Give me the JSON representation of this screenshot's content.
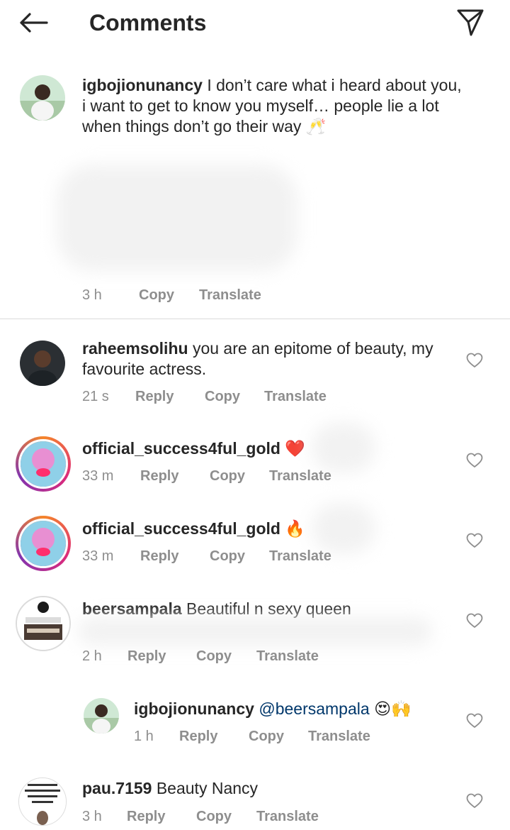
{
  "header": {
    "title": "Comments",
    "back_icon": "arrow-left-icon",
    "share_icon": "send-icon"
  },
  "caption": {
    "username": "igbojionunancy",
    "text": "I don’t care what i heard about you, i want to get to know you myself… people lie a lot when things don’t go their way 🥂",
    "time": "3 h",
    "copy": "Copy",
    "translate": "Translate"
  },
  "comments": [
    {
      "username": "raheemsolihu",
      "text": "you are an epitome of beauty, my favourite actress.",
      "time": "21 s",
      "reply": "Reply",
      "copy": "Copy",
      "translate": "Translate"
    },
    {
      "username": "official_success4ful_gold",
      "text": "❤️",
      "time": "33 m",
      "reply": "Reply",
      "copy": "Copy",
      "translate": "Translate"
    },
    {
      "username": "official_success4ful_gold",
      "text": "🔥",
      "time": "33 m",
      "reply": "Reply",
      "copy": "Copy",
      "translate": "Translate"
    },
    {
      "username": "beersampala",
      "text": "Beautiful n sexy queen",
      "time": "2 h",
      "reply": "Reply",
      "copy": "Copy",
      "translate": "Translate"
    },
    {
      "username": "igbojionunancy",
      "mention": "@beersampala",
      "text": "😍🙌",
      "time": "1 h",
      "reply": "Reply",
      "copy": "Copy",
      "translate": "Translate"
    },
    {
      "username": "pau.7159",
      "text": "Beauty Nancy",
      "time": "3 h",
      "reply": "Reply",
      "copy": "Copy",
      "translate": "Translate"
    }
  ],
  "colors": {
    "text": "#262626",
    "secondary": "#8e8e8e",
    "mention": "#00376b",
    "divider": "#dbdbdb"
  }
}
